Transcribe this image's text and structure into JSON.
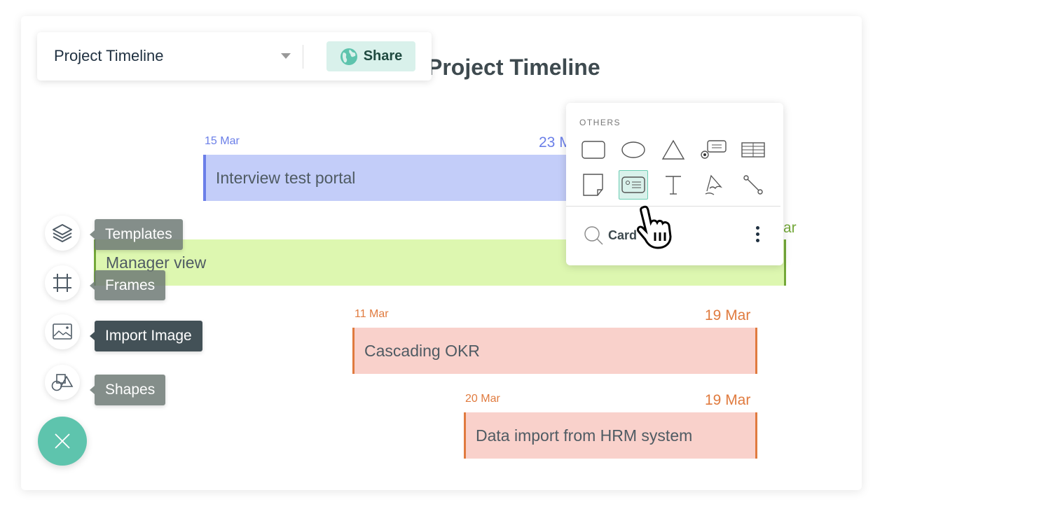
{
  "toolbar": {
    "document_name": "Project Timeline",
    "share_label": "Share",
    "share_icon": "globe-icon"
  },
  "canvas": {
    "title": "Project Timeline",
    "tasks": [
      {
        "name": "Interview test portal",
        "start_label": "15 Mar",
        "end_label": "23 M",
        "color": "#c3cdf9",
        "accent": "#6b7fe8"
      },
      {
        "name": "Manager view",
        "start_label": "",
        "end_label": "ar",
        "color": "#ddf7b0",
        "accent": "#74a83a"
      },
      {
        "name": "Cascading OKR",
        "start_label": "11 Mar",
        "end_label": "19 Mar",
        "color": "#f9d1cb",
        "accent": "#e07b3f"
      },
      {
        "name": "Data import from HRM system",
        "start_label": "20 Mar",
        "end_label": "19 Mar",
        "color": "#f9d1cb",
        "accent": "#e07b3f"
      }
    ]
  },
  "shape_popup": {
    "heading": "OTHERS",
    "shapes": [
      "rectangle",
      "ellipse",
      "triangle",
      "callout",
      "table",
      "sticky-note",
      "card",
      "text",
      "freehand",
      "connector"
    ],
    "selected": "card",
    "search_value": "Card"
  },
  "side_menu": {
    "items": [
      {
        "label": "Templates",
        "icon": "layers-icon"
      },
      {
        "label": "Frames",
        "icon": "frame-icon"
      },
      {
        "label": "Import Image",
        "icon": "image-icon"
      },
      {
        "label": "Shapes",
        "icon": "shapes-icon"
      }
    ],
    "close_icon": "close-icon",
    "accent": "#5ec4ad"
  }
}
